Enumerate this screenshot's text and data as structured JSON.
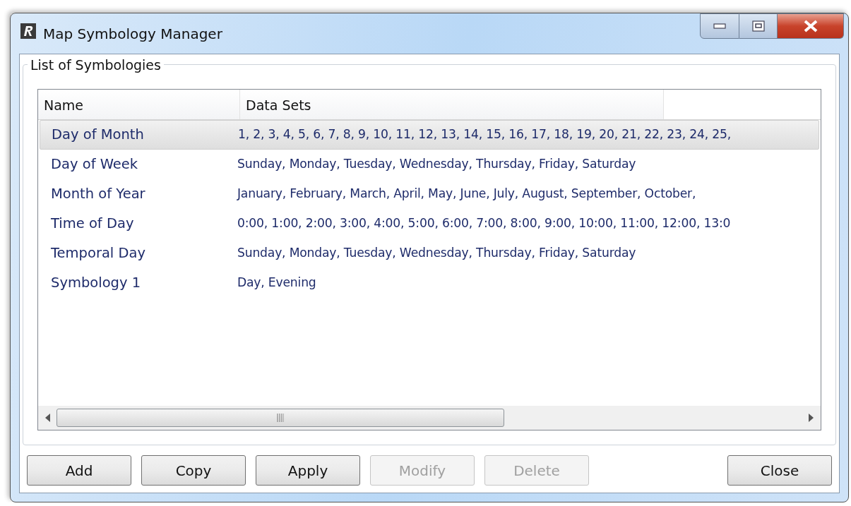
{
  "window": {
    "title": "Map Symbology Manager"
  },
  "group": {
    "title": "List of Symbologies"
  },
  "table": {
    "columns": [
      "Name",
      "Data Sets"
    ],
    "rows": [
      {
        "name": "Day of Month",
        "data_sets": "1, 2, 3, 4, 5, 6, 7, 8, 9, 10, 11, 12, 13, 14, 15, 16, 17, 18, 19, 20, 21, 22, 23, 24, 25,",
        "selected": true
      },
      {
        "name": "Day of Week",
        "data_sets": "Sunday, Monday, Tuesday, Wednesday, Thursday, Friday, Saturday",
        "selected": false
      },
      {
        "name": "Month of Year",
        "data_sets": "January, February, March, April, May, June, July, August, September, October,",
        "selected": false
      },
      {
        "name": "Time of Day",
        "data_sets": "0:00, 1:00, 2:00, 3:00, 4:00, 5:00, 6:00, 7:00, 8:00, 9:00, 10:00, 11:00, 12:00, 13:0",
        "selected": false
      },
      {
        "name": "Temporal Day",
        "data_sets": "Sunday, Monday, Tuesday, Wednesday, Thursday, Friday, Saturday",
        "selected": false
      },
      {
        "name": "Symbology 1",
        "data_sets": "Day, Evening",
        "selected": false
      }
    ]
  },
  "buttons": [
    {
      "label": "Add",
      "disabled": false
    },
    {
      "label": "Copy",
      "disabled": false
    },
    {
      "label": "Apply",
      "disabled": false
    },
    {
      "label": "Modify",
      "disabled": true
    },
    {
      "label": "Delete",
      "disabled": true
    }
  ],
  "close_button": {
    "label": "Close",
    "disabled": false
  }
}
